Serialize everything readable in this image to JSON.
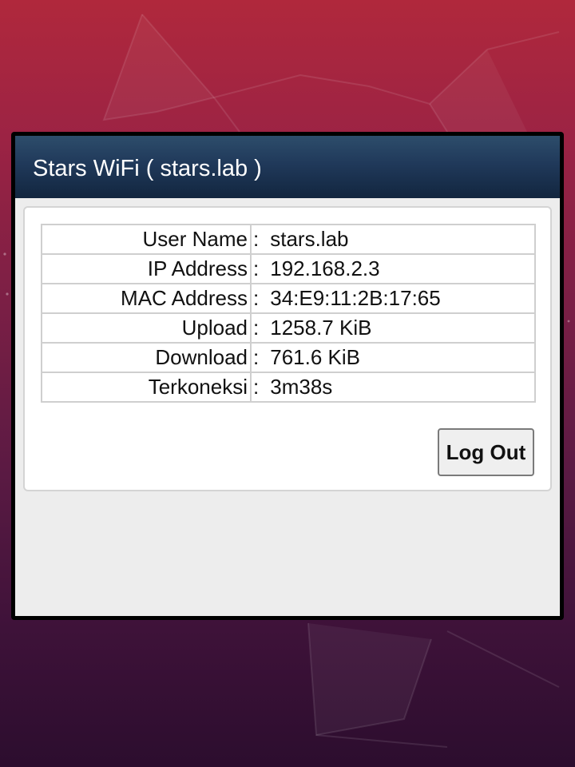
{
  "window": {
    "title": "Stars WiFi ( stars.lab )"
  },
  "status_table": {
    "separator": ":",
    "rows": [
      {
        "label": "User Name",
        "value": "stars.lab"
      },
      {
        "label": "IP Address",
        "value": "192.168.2.3"
      },
      {
        "label": "MAC Address",
        "value": "34:E9:11:2B:17:65"
      },
      {
        "label": "Upload",
        "value": "1258.7 KiB"
      },
      {
        "label": "Download",
        "value": "761.6 KiB"
      },
      {
        "label": "Terkoneksi",
        "value": "3m38s"
      }
    ]
  },
  "actions": {
    "logout_label": "Log Out"
  },
  "colors": {
    "titlebar_top": "#2d4d6b",
    "titlebar_bottom": "#12263f",
    "wallpaper_top": "#b0283c",
    "wallpaper_bottom": "#2c0d2e"
  }
}
